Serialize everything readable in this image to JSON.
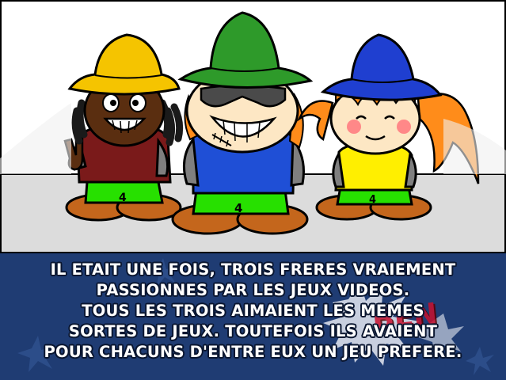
{
  "caption": {
    "lines": [
      "IL ETAIT UNE FOIS, TROIS FRERES VRAIEMENT",
      "PASSIONNES PAR LES JEUX VIDEOS.",
      "TOUS LES TROIS AIMAIENT LES MEMES",
      "SORTES DE JEUX. TOUTEFOIS ILS AVAIENT",
      "POUR CHACUNS D'ENTRE EUX UN JEU PREFERE."
    ]
  },
  "characters": [
    {
      "role": "left-brother",
      "hat_color": "#f5c400",
      "shirt_color": "#7a1a1a",
      "shorts_label": "4"
    },
    {
      "role": "middle-brother",
      "hat_color": "#2e9a2a",
      "shirt_color": "#1f4fd6",
      "shorts_label": "4"
    },
    {
      "role": "right-sister",
      "hat_color": "#1f3fd0",
      "shirt_color": "#ffef00",
      "shorts_label": "4"
    }
  ],
  "colors": {
    "floor": "#dcdcdc",
    "wall": "#ffffff",
    "caption_bg": "#1f3c73",
    "brand_logo": "#c8102e"
  },
  "logo": {
    "text": "BEN"
  }
}
